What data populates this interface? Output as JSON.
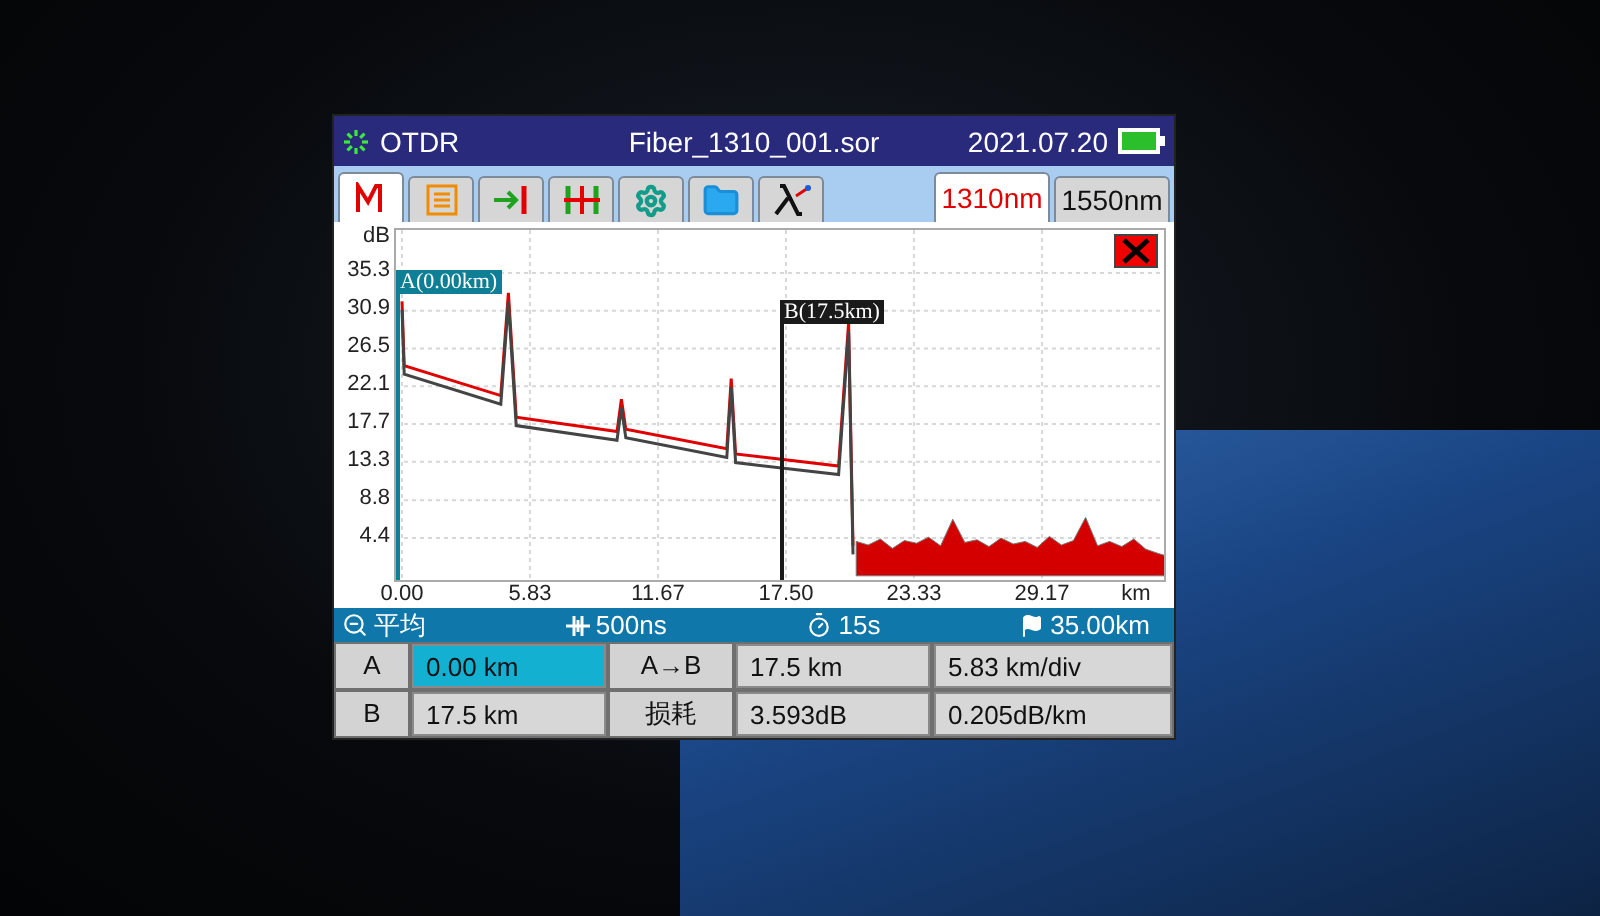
{
  "title_bar": {
    "app": "OTDR",
    "file": "Fiber_1310_001.sor",
    "date": "2021.07.20"
  },
  "tool_tabs": [
    {
      "selected": true
    },
    {
      "selected": false
    },
    {
      "selected": false
    },
    {
      "selected": false
    },
    {
      "selected": false
    },
    {
      "selected": false
    },
    {
      "selected": false
    }
  ],
  "wavelength_tabs": [
    {
      "label": "1310nm",
      "selected": true
    },
    {
      "label": "1550nm",
      "selected": false
    }
  ],
  "chart": {
    "markers": [
      {
        "label": "A(0.00km)",
        "color": "#0f7f95"
      },
      {
        "label": "B(17.5km)",
        "color": "#1a1a1a"
      }
    ],
    "chart_data": {
      "type": "line",
      "xlabel": "km",
      "ylabel": "dB",
      "grid": true,
      "xlim": [
        0,
        35
      ],
      "ylim": [
        0,
        40
      ],
      "xticks": [
        {
          "value": 0,
          "label": "0.00"
        },
        {
          "value": 5.83,
          "label": "5.83"
        },
        {
          "value": 11.67,
          "label": "11.67"
        },
        {
          "value": 17.5,
          "label": "17.50"
        },
        {
          "value": 23.33,
          "label": "23.33"
        },
        {
          "value": 29.17,
          "label": "29.17"
        }
      ],
      "yticks": [
        {
          "value": 35.3,
          "label": "35.3"
        },
        {
          "value": 30.9,
          "label": "30.9"
        },
        {
          "value": 26.5,
          "label": "26.5"
        },
        {
          "value": 22.1,
          "label": "22.1"
        },
        {
          "value": 17.7,
          "label": "17.7"
        },
        {
          "value": 13.3,
          "label": "13.3"
        },
        {
          "value": 8.8,
          "label": "8.8"
        },
        {
          "value": 4.4,
          "label": "4.4"
        }
      ],
      "x": [
        0,
        0.1,
        4.5,
        4.85,
        5.2,
        9.8,
        10,
        10.2,
        14.8,
        15,
        15.2,
        19.9,
        20.35,
        20.55,
        20.7,
        21.25,
        21.8,
        22.35,
        22.9,
        23.45,
        24,
        24.55,
        25.1,
        25.65,
        26.2,
        26.75,
        27.3,
        27.85,
        28.4,
        28.95,
        29.5,
        30.05,
        30.6,
        31.15,
        31.7,
        32.25,
        32.8,
        33.35,
        33.9,
        34.45,
        35
      ],
      "series": [
        {
          "color": "#e00000",
          "values": [
            32.0,
            24.5,
            21.0,
            33.0,
            18.5,
            16.8,
            20.6,
            17.1,
            14.8,
            23.0,
            14.2,
            12.8,
            29.5,
            3.5,
            null,
            null,
            null,
            null,
            null,
            null,
            null,
            null,
            null,
            null,
            null,
            null,
            null,
            null,
            null,
            null,
            null,
            null,
            null,
            null,
            null,
            null,
            null,
            null,
            null,
            null,
            null
          ]
        },
        {
          "color": "#444444",
          "values": [
            31.0,
            23.5,
            20.0,
            32.0,
            17.5,
            15.8,
            19.6,
            16.1,
            13.8,
            22.0,
            13.2,
            11.8,
            28.5,
            2.5,
            null,
            null,
            null,
            null,
            null,
            null,
            null,
            null,
            null,
            null,
            null,
            null,
            null,
            null,
            null,
            null,
            null,
            null,
            null,
            null,
            null,
            null,
            null,
            null,
            null,
            null,
            null
          ]
        },
        {
          "type": "area",
          "color": "#d40000",
          "values": [
            null,
            null,
            null,
            null,
            null,
            null,
            null,
            null,
            null,
            null,
            null,
            null,
            null,
            null,
            4.0,
            3.6,
            4.3,
            3.2,
            4.1,
            3.8,
            4.5,
            3.5,
            6.6,
            3.9,
            4.2,
            3.4,
            4.4,
            3.7,
            4.0,
            3.3,
            4.6,
            3.6,
            4.1,
            6.8,
            3.5,
            4.0,
            3.4,
            4.3,
            3.1,
            2.6,
            2.2
          ]
        }
      ]
    }
  },
  "status_bar": [
    {
      "kind": "average",
      "text": "平均"
    },
    {
      "kind": "pulse",
      "text": "500ns"
    },
    {
      "kind": "time",
      "text": "15s"
    },
    {
      "kind": "range",
      "text": "35.00km"
    }
  ],
  "table": {
    "rows": [
      {
        "marker": "A",
        "position": "0.00 km",
        "selected": true,
        "label": "A→B",
        "values": [
          "17.5 km",
          "5.83 km/div"
        ]
      },
      {
        "marker": "B",
        "position": "17.5 km",
        "selected": false,
        "label": "损耗",
        "values": [
          "3.593dB",
          "0.205dB/km"
        ]
      }
    ]
  }
}
